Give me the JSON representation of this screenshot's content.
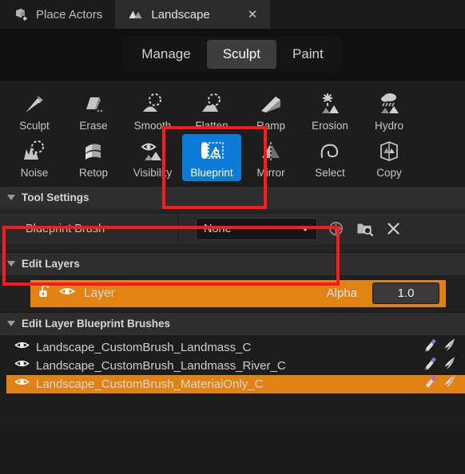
{
  "tabs": [
    {
      "label": "Place Actors",
      "icon": "cube-plus-icon",
      "active": false,
      "closable": false
    },
    {
      "label": "Landscape",
      "icon": "mountain-icon",
      "active": true,
      "closable": true,
      "close_label": "✕"
    }
  ],
  "modes": [
    {
      "label": "Manage",
      "selected": false
    },
    {
      "label": "Sculpt",
      "selected": true
    },
    {
      "label": "Paint",
      "selected": false
    }
  ],
  "tools": {
    "row1": [
      {
        "label": "Sculpt",
        "icon": "trowel-icon",
        "active": false
      },
      {
        "label": "Erase",
        "icon": "eraser-icon",
        "active": false
      },
      {
        "label": "Smooth",
        "icon": "smooth-icon",
        "active": false
      },
      {
        "label": "Flatten",
        "icon": "flatten-icon",
        "active": false
      },
      {
        "label": "Ramp",
        "icon": "ramp-icon",
        "active": false
      },
      {
        "label": "Erosion",
        "icon": "sun-erosion-icon",
        "active": false
      },
      {
        "label": "Hydro",
        "icon": "rain-cloud-icon",
        "active": false
      }
    ],
    "row2": [
      {
        "label": "Noise",
        "icon": "noise-icon",
        "active": false
      },
      {
        "label": "Retop",
        "icon": "retopology-icon",
        "active": false
      },
      {
        "label": "Visibility",
        "icon": "eye-mountain-icon",
        "active": false
      },
      {
        "label": "Blueprint",
        "icon": "blueprint-icon",
        "active": true
      },
      {
        "label": "Mirror",
        "icon": "mirror-icon",
        "active": false
      },
      {
        "label": "Select",
        "icon": "lasso-select-icon",
        "active": false
      },
      {
        "label": "Copy",
        "icon": "copy-cube-icon",
        "active": false
      }
    ]
  },
  "sections": {
    "tool_settings": "Tool Settings",
    "edit_layers": "Edit Layers",
    "edit_layer_blueprint_brushes": "Edit Layer Blueprint Brushes"
  },
  "tool_settings": {
    "property_name": "Blueprint Brush",
    "combo_value": "None",
    "actions": [
      {
        "name": "use-selected-asset-icon",
        "tooltip": "Use Selected Asset"
      },
      {
        "name": "browse-asset-icon",
        "tooltip": "Browse"
      },
      {
        "name": "clear-asset-icon",
        "tooltip": "Clear",
        "glyph": "✕"
      }
    ]
  },
  "edit_layers": {
    "layer": {
      "name": "Layer",
      "lock_icon": "unlocked-padlock-icon",
      "visibility_icon": "eye-icon",
      "alpha_label": "Alpha",
      "alpha_value": "1.0"
    }
  },
  "blueprint_brushes": [
    {
      "name": "Landscape_CustomBrush_Landmass_C",
      "visible": true,
      "selected": false
    },
    {
      "name": "Landscape_CustomBrush_Landmass_River_C",
      "visible": true,
      "selected": false
    },
    {
      "name": "Landscape_CustomBrush_MaterialOnly_C",
      "visible": true,
      "selected": true
    }
  ],
  "annotations": [
    {
      "name": "highlight-blueprint-tool",
      "color": "#ff1a1a"
    },
    {
      "name": "highlight-blueprint-brush",
      "color": "#ff1a1a"
    }
  ],
  "colors": {
    "accent_blue": "#0c7bd8",
    "accent_orange": "#e08214",
    "annotation_red": "#ff1a1a",
    "panel_bg": "#1d1d1d",
    "header_bg": "#2e2e2e"
  }
}
